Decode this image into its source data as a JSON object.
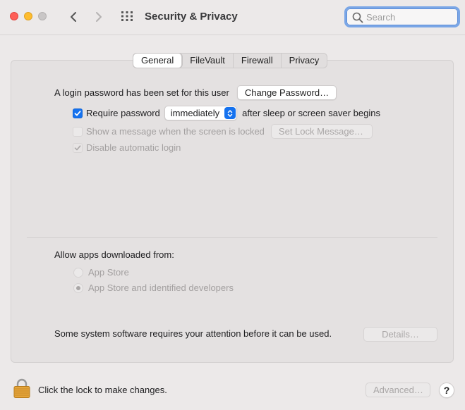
{
  "window": {
    "title": "Security & Privacy",
    "search_placeholder": "Search"
  },
  "tabs": [
    {
      "label": "General",
      "active": true
    },
    {
      "label": "FileVault",
      "active": false
    },
    {
      "label": "Firewall",
      "active": false
    },
    {
      "label": "Privacy",
      "active": false
    }
  ],
  "general": {
    "login_password_text": "A login password has been set for this user",
    "change_password_label": "Change Password…",
    "require_password_label": "Require password",
    "require_password_checked": true,
    "require_password_value": "immediately",
    "after_sleep_text": "after sleep or screen saver begins",
    "show_message_label": "Show a message when the screen is locked",
    "show_message_checked": false,
    "set_lock_message_label": "Set Lock Message…",
    "disable_auto_login_label": "Disable automatic login",
    "disable_auto_login_checked": true
  },
  "allow_apps": {
    "heading": "Allow apps downloaded from:",
    "options": [
      {
        "label": "App Store",
        "selected": false
      },
      {
        "label": "App Store and identified developers",
        "selected": true
      }
    ]
  },
  "system_software": {
    "text": "Some system software requires your attention before it can be used.",
    "details_label": "Details…"
  },
  "footer": {
    "lock_text": "Click the lock to make changes.",
    "advanced_label": "Advanced…",
    "help_label": "?"
  },
  "icons": {
    "close": "traffic-light-close",
    "minimize": "traffic-light-minimize",
    "zoom": "traffic-light-zoom",
    "back": "chevron-left-icon",
    "forward": "chevron-right-icon",
    "grid": "grid-icon",
    "search": "magnifier-icon",
    "lock": "lock-icon"
  },
  "colors": {
    "accent": "#1572ef",
    "background": "#ece9e9",
    "lock_gold": "#e5a53a"
  }
}
